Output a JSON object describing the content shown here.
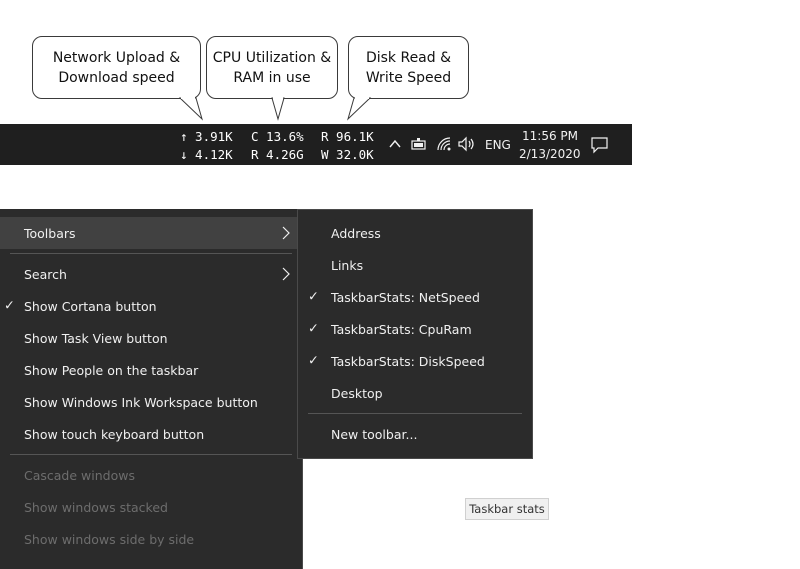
{
  "callouts": {
    "network": "Network Upload &\nDownload speed",
    "cpu": "CPU Utilization &\nRAM in use",
    "disk": "Disk Read &\nWrite Speed"
  },
  "taskbar": {
    "net_upload": "↑ 3.91K",
    "net_download": "↓ 4.12K",
    "cpu": "C 13.6%",
    "ram": "R 4.26G",
    "disk_read": "R 96.1K",
    "disk_write": "W 32.0K",
    "language": "ENG",
    "time": "11:56 PM",
    "date": "2/13/2020",
    "icons": [
      "chevron-up-icon",
      "battery-icon",
      "wifi-icon",
      "speaker-icon",
      "notification-icon"
    ]
  },
  "context_menu": {
    "items": [
      {
        "label": "Toolbars",
        "submenu": true,
        "checked": false,
        "disabled": false,
        "hover": true
      },
      {
        "label": "Search",
        "submenu": true,
        "checked": false,
        "disabled": false
      },
      {
        "label": "Show Cortana button",
        "checked": true,
        "disabled": false
      },
      {
        "label": "Show Task View button",
        "checked": false,
        "disabled": false
      },
      {
        "label": "Show People on the taskbar",
        "checked": false,
        "disabled": false
      },
      {
        "label": "Show Windows Ink Workspace button",
        "checked": false,
        "disabled": false
      },
      {
        "label": "Show touch keyboard button",
        "checked": false,
        "disabled": false
      },
      {
        "label": "Cascade windows",
        "checked": false,
        "disabled": true
      },
      {
        "label": "Show windows stacked",
        "checked": false,
        "disabled": true
      },
      {
        "label": "Show windows side by side",
        "checked": false,
        "disabled": true
      }
    ]
  },
  "submenu": {
    "items": [
      {
        "label": "Address",
        "checked": false
      },
      {
        "label": "Links",
        "checked": false
      },
      {
        "label": "TaskbarStats: NetSpeed",
        "checked": true
      },
      {
        "label": "TaskbarStats: CpuRam",
        "checked": true
      },
      {
        "label": "TaskbarStats: DiskSpeed",
        "checked": true
      },
      {
        "label": "Desktop",
        "checked": false
      },
      {
        "label": "New toolbar...",
        "checked": false
      }
    ]
  },
  "tooltip": {
    "text": "Taskbar stats"
  },
  "colors": {
    "taskbar_bg": "#1f1f1f",
    "menu_bg": "#2b2b2b",
    "menu_hover": "#414141",
    "menu_text": "#f0f0f0",
    "menu_disabled_text": "#6d6d6d"
  }
}
